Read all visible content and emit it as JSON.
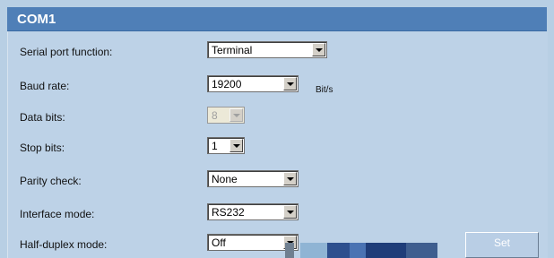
{
  "section": {
    "title": "COM1"
  },
  "fields": [
    {
      "label": "Serial port function:",
      "value": "Terminal"
    },
    {
      "label": "Baud rate:",
      "value": "19200",
      "unit": "Bit/s"
    },
    {
      "label": "Data bits:",
      "value": "8"
    },
    {
      "label": "Stop bits:",
      "value": "1"
    },
    {
      "label": "Parity check:",
      "value": "None"
    },
    {
      "label": "Interface mode:",
      "value": "RS232"
    },
    {
      "label": "Half-duplex mode:",
      "value": "Off"
    }
  ],
  "actions": {
    "set_label": "Set"
  },
  "colors": {
    "header": "#4f7fb7",
    "panel": "#bdd2e7",
    "header_text": "#ffffff"
  },
  "icons": {
    "dropdown": "chevron-down-icon"
  }
}
